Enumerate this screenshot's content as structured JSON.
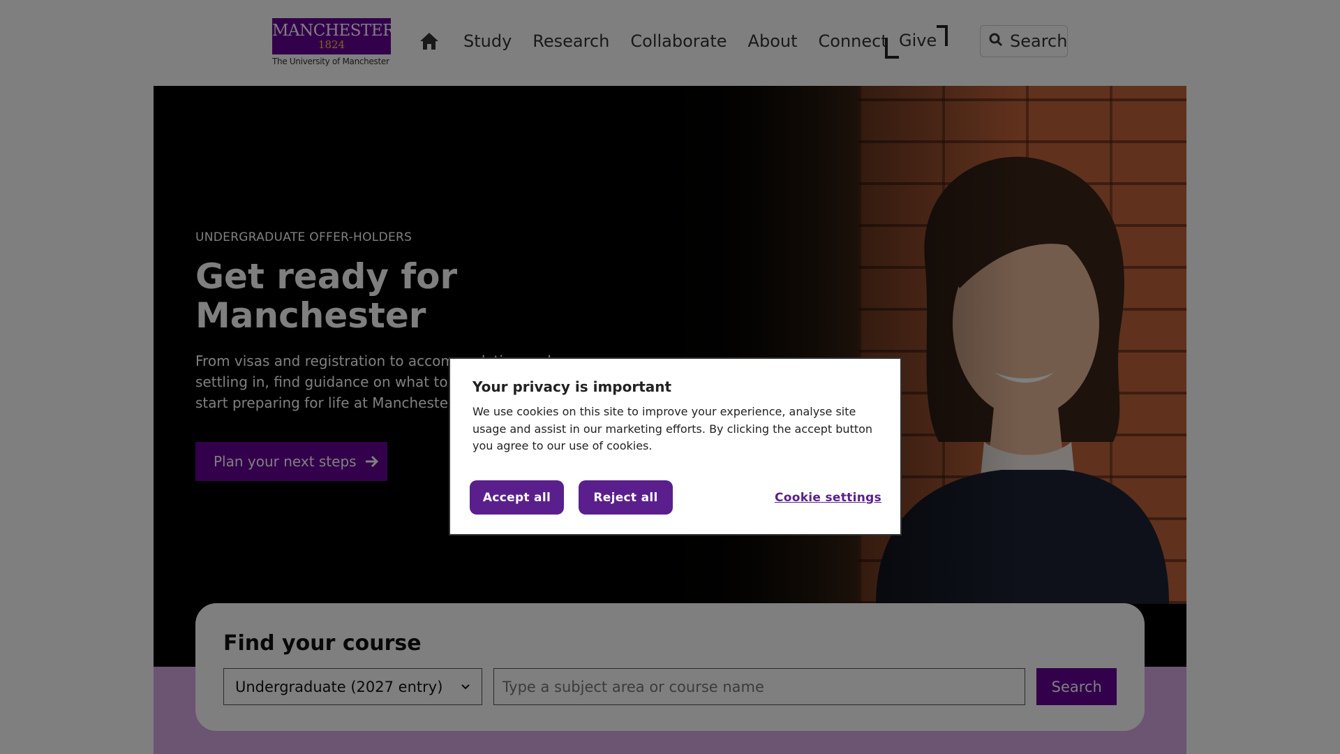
{
  "header": {
    "logo": {
      "word": "MANCHESTER",
      "year": "1824",
      "subtitle": "The University of Manchester"
    },
    "nav": [
      "Study",
      "Research",
      "Collaborate",
      "About",
      "Connect"
    ],
    "give_label": "Give",
    "search_label": "Search"
  },
  "hero": {
    "eyebrow": "UNDERGRADUATE OFFER-HOLDERS",
    "title_line1": "Get ready for",
    "title_line2": "Manchester",
    "description": "From visas and registration to accommodation and settling in, find guidance on what to do next and start preparing for life at Manchester.",
    "cta_label": "Plan your next steps"
  },
  "course_finder": {
    "title": "Find your course",
    "selected_level": "Undergraduate (2027 entry)",
    "input_value": "",
    "input_placeholder": "Type a subject area or course name",
    "search_label": "Search"
  },
  "cookie_modal": {
    "title": "Your privacy is important",
    "body": "We use cookies on this site to improve your experience, analyse site usage and assist in our marketing efforts. By clicking the accept button you agree to our use of cookies.",
    "accept_label": "Accept all",
    "reject_label": "Reject all",
    "settings_label": "Cookie settings"
  },
  "colors": {
    "brand_purple": "#660099",
    "brand_gold": "#ffcc33",
    "lilac_band": "#d8a8e6",
    "modal_button": "#5a1f8c"
  }
}
